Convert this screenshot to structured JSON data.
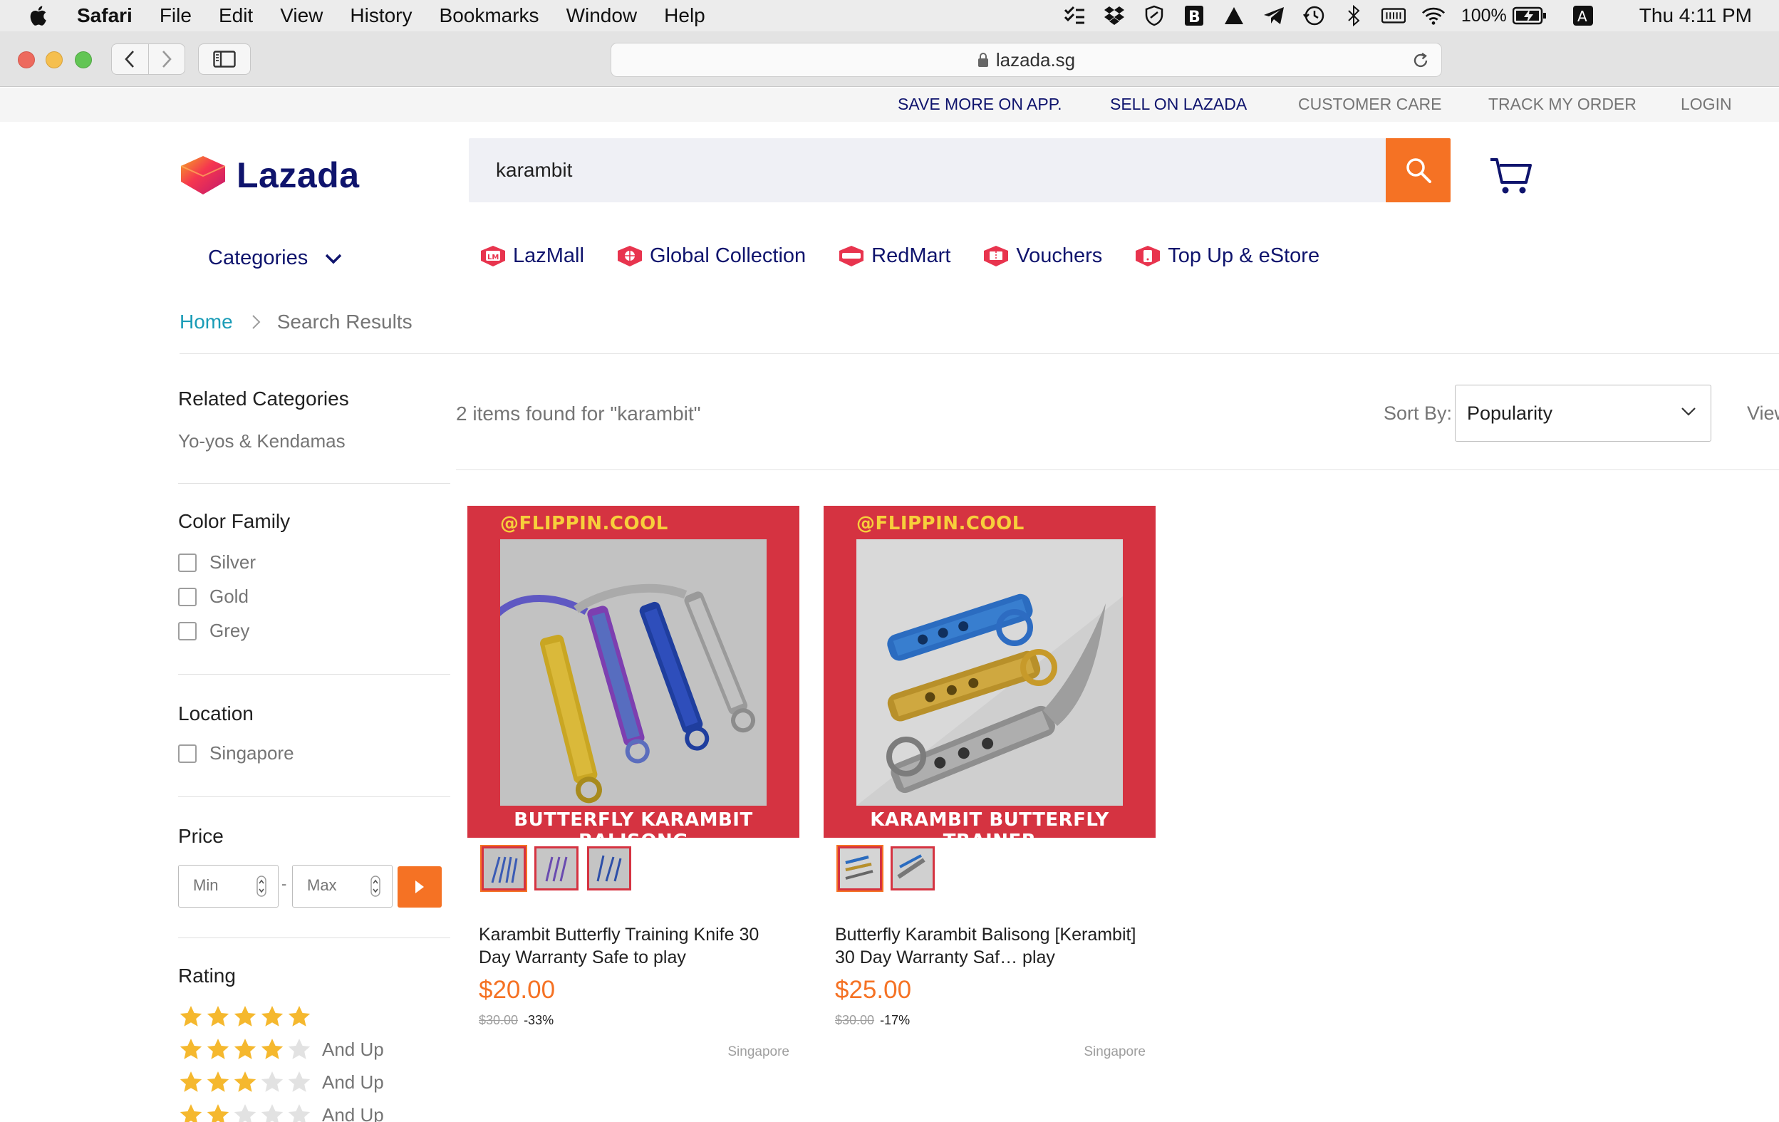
{
  "menubar": {
    "app_name": "Safari",
    "items": [
      "File",
      "Edit",
      "View",
      "History",
      "Bookmarks",
      "Window",
      "Help"
    ],
    "battery": "100%",
    "input_source": "A",
    "clock": "Thu 4:11 PM"
  },
  "browser": {
    "url": "lazada.sg"
  },
  "topstrip": {
    "save_more": "SAVE MORE ON APP.",
    "sell": "SELL ON LAZADA",
    "customer_care": "CUSTOMER CARE",
    "track_order": "TRACK MY ORDER",
    "login": "LOGIN"
  },
  "header": {
    "logo_text": "Lazada",
    "search_value": "karambit"
  },
  "nav": {
    "categories_label": "Categories",
    "links": [
      {
        "label": "LazMall",
        "icon": "lazmall-icon"
      },
      {
        "label": "Global Collection",
        "icon": "global-collection-icon"
      },
      {
        "label": "RedMart",
        "icon": "redmart-icon"
      },
      {
        "label": "Vouchers",
        "icon": "vouchers-icon"
      },
      {
        "label": "Top Up & eStore",
        "icon": "topup-icon"
      }
    ]
  },
  "breadcrumb": {
    "home": "Home",
    "current": "Search Results"
  },
  "filters": {
    "related_title": "Related Categories",
    "related_item": "Yo-yos & Kendamas",
    "color_title": "Color Family",
    "colors": [
      "Silver",
      "Gold",
      "Grey"
    ],
    "location_title": "Location",
    "locations": [
      "Singapore"
    ],
    "price_title": "Price",
    "price_min_placeholder": "Min",
    "price_max_placeholder": "Max",
    "price_separator": "-",
    "rating_title": "Rating",
    "rating_rows": [
      5,
      4,
      3,
      2
    ],
    "and_up": "And Up"
  },
  "results": {
    "count_text": "2 items found for \"karambit\"",
    "sort_label": "Sort By:",
    "sort_value": "Popularity",
    "view_label": "View"
  },
  "products": [
    {
      "banner_handle": "@FLIPPIN.COOL",
      "banner_caption": "BUTTERFLY KARAMBIT BALISONG",
      "title": "Karambit Butterfly Training Knife 30 Day Warranty Safe to play",
      "price": "$20.00",
      "original_price": "$30.00",
      "discount": "-33%",
      "location": "Singapore",
      "thumb_count": 3
    },
    {
      "banner_handle": "@FLIPPIN.COOL",
      "banner_caption": "KARAMBIT BUTTERFLY TRAINER",
      "title": "Butterfly Karambit Balisong [Kerambit] 30 Day Warranty Saf… play",
      "price": "$25.00",
      "original_price": "$30.00",
      "discount": "-17%",
      "location": "Singapore",
      "thumb_count": 2
    }
  ],
  "colors": {
    "brand_navy": "#0f146d",
    "accent_orange": "#f57224",
    "link_teal": "#1a9cb7",
    "star_gold": "#f5b82e",
    "banner_red": "#d53341"
  }
}
